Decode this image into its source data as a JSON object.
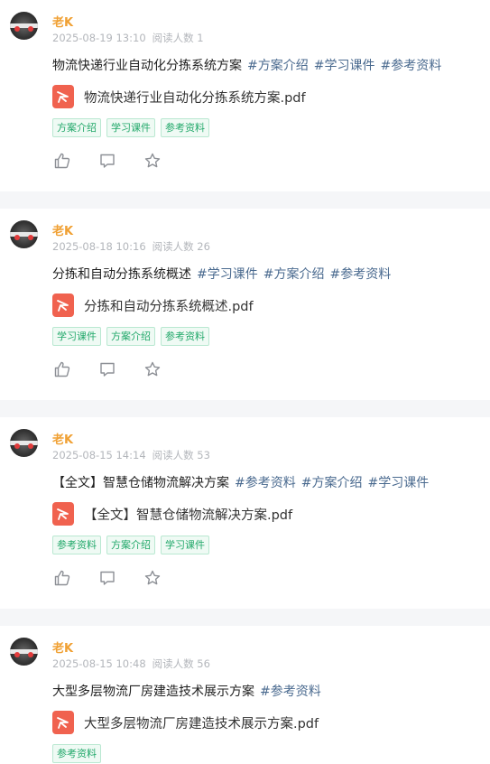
{
  "posts": [
    {
      "author": "老K",
      "date": "2025-08-19 13:10",
      "views": "阅读人数 1",
      "title": "物流快递行业自动化分拣系统方案",
      "title_tags": [
        "#方案介绍",
        "#学习课件",
        "#参考资料"
      ],
      "file_name": "物流快递行业自动化分拣系统方案.pdf",
      "chips": [
        "方案介绍",
        "学习课件",
        "参考资料"
      ]
    },
    {
      "author": "老K",
      "date": "2025-08-18 10:16",
      "views": "阅读人数 26",
      "title": "分拣和自动分拣系统概述",
      "title_tags": [
        "#学习课件",
        "#方案介绍",
        "#参考资料"
      ],
      "file_name": "分拣和自动分拣系统概述.pdf",
      "chips": [
        "学习课件",
        "方案介绍",
        "参考资料"
      ]
    },
    {
      "author": "老K",
      "date": "2025-08-15 14:14",
      "views": "阅读人数 53",
      "title": "【全文】智慧仓储物流解决方案",
      "title_tags": [
        "#参考资料",
        "#方案介绍",
        "#学习课件"
      ],
      "file_name": "【全文】智慧仓储物流解决方案.pdf",
      "chips": [
        "参考资料",
        "方案介绍",
        "学习课件"
      ]
    },
    {
      "author": "老K",
      "date": "2025-08-15 10:48",
      "views": "阅读人数 56",
      "title": "大型多层物流厂房建造技术展示方案",
      "title_tags": [
        "#参考资料"
      ],
      "file_name": "大型多层物流厂房建造技术展示方案.pdf",
      "chips": [
        "参考资料"
      ]
    }
  ],
  "icons": {
    "like": "thumbs-up-icon",
    "comment": "comment-icon",
    "favorite": "star-icon",
    "file": "pdf-icon"
  },
  "colors": {
    "author": "#f0a033",
    "hashtag": "#4a6a8f",
    "chip_text": "#22a86a",
    "pdf": "#f0624f"
  }
}
